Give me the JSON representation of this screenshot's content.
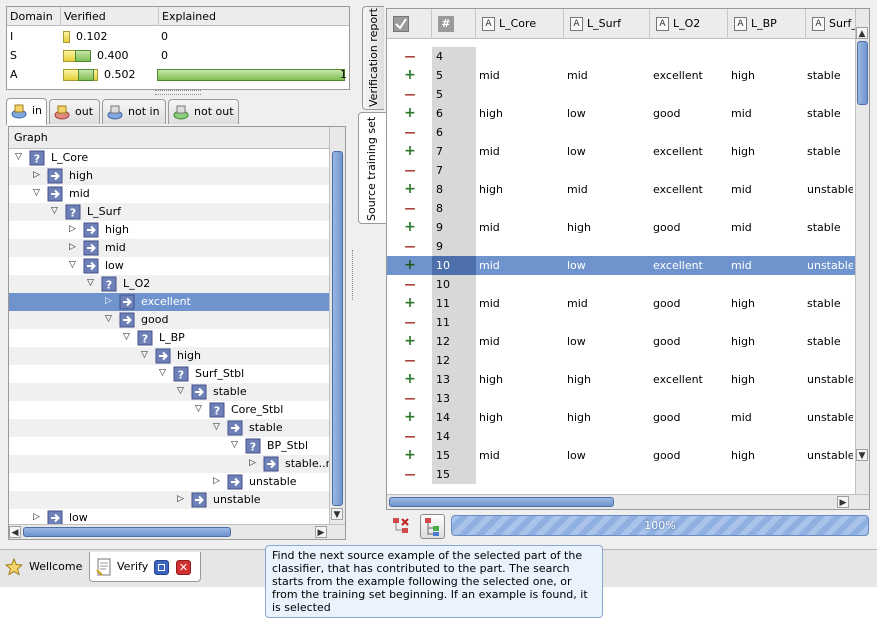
{
  "domain_table": {
    "headers": [
      "Domain",
      "Verified",
      "Explained"
    ],
    "rows": [
      {
        "domain": "I",
        "verified": "0.102",
        "explained": "0",
        "verified_bar": 0.102,
        "explained_bar": 0
      },
      {
        "domain": "S",
        "verified": "0.400",
        "explained": "0",
        "verified_bar": 0.4,
        "explained_bar": 0
      },
      {
        "domain": "A",
        "verified": "0.502",
        "explained": "1",
        "verified_bar": 0.502,
        "explained_bar": 1
      }
    ]
  },
  "left_tabs": [
    {
      "label": "in",
      "icon": "in-icon",
      "active": true
    },
    {
      "label": "out",
      "icon": "out-icon",
      "active": false
    },
    {
      "label": "not in",
      "icon": "not-in-icon",
      "active": false
    },
    {
      "label": "not out",
      "icon": "not-out-icon",
      "active": false
    }
  ],
  "tree": {
    "header": "Graph",
    "rows": [
      {
        "label": "L_Core",
        "depth": 0,
        "expanded": true,
        "type": "question",
        "selected": false
      },
      {
        "label": "high",
        "depth": 1,
        "expanded": false,
        "type": "arrow",
        "selected": false
      },
      {
        "label": "mid",
        "depth": 1,
        "expanded": true,
        "type": "arrow",
        "selected": false
      },
      {
        "label": "L_Surf",
        "depth": 2,
        "expanded": true,
        "type": "question",
        "selected": false
      },
      {
        "label": "high",
        "depth": 3,
        "expanded": false,
        "type": "arrow",
        "selected": false
      },
      {
        "label": "mid",
        "depth": 3,
        "expanded": false,
        "type": "arrow",
        "selected": false
      },
      {
        "label": "low",
        "depth": 3,
        "expanded": true,
        "type": "arrow",
        "selected": false
      },
      {
        "label": "L_O2",
        "depth": 4,
        "expanded": true,
        "type": "question",
        "selected": false
      },
      {
        "label": "excellent",
        "depth": 5,
        "expanded": false,
        "type": "arrow",
        "selected": true
      },
      {
        "label": "good",
        "depth": 5,
        "expanded": true,
        "type": "arrow",
        "selected": false
      },
      {
        "label": "L_BP",
        "depth": 6,
        "expanded": true,
        "type": "question",
        "selected": false
      },
      {
        "label": "high",
        "depth": 7,
        "expanded": true,
        "type": "arrow",
        "selected": false
      },
      {
        "label": "Surf_Stbl",
        "depth": 8,
        "expanded": true,
        "type": "question",
        "selected": false
      },
      {
        "label": "stable",
        "depth": 9,
        "expanded": true,
        "type": "arrow",
        "selected": false
      },
      {
        "label": "Core_Stbl",
        "depth": 10,
        "expanded": true,
        "type": "question",
        "selected": false
      },
      {
        "label": "stable",
        "depth": 11,
        "expanded": true,
        "type": "arrow",
        "selected": false
      },
      {
        "label": "BP_Stbl",
        "depth": 12,
        "expanded": true,
        "type": "question",
        "selected": false
      },
      {
        "label": "stable..r",
        "depth": 13,
        "expanded": false,
        "type": "arrow",
        "selected": false
      },
      {
        "label": "unstable",
        "depth": 11,
        "expanded": false,
        "type": "arrow",
        "selected": false
      },
      {
        "label": "unstable",
        "depth": 9,
        "expanded": false,
        "type": "arrow",
        "selected": false
      },
      {
        "label": "low",
        "depth": 1,
        "expanded": false,
        "type": "arrow",
        "selected": false
      }
    ]
  },
  "vertical_tabs": {
    "verification_report": "Verification report",
    "source_training_set": "Source training set"
  },
  "grid": {
    "hash_header": "#",
    "columns": [
      "L_Core",
      "L_Surf",
      "L_O2",
      "L_BP",
      "Surf_Stbl"
    ],
    "rows": [
      {
        "sign": "-",
        "num": "4",
        "values": [
          "",
          "",
          "",
          "",
          ""
        ]
      },
      {
        "sign": "+",
        "num": "5",
        "values": [
          "mid",
          "mid",
          "excellent",
          "high",
          "stable"
        ]
      },
      {
        "sign": "-",
        "num": "5",
        "values": [
          "",
          "",
          "",
          "",
          ""
        ]
      },
      {
        "sign": "+",
        "num": "6",
        "values": [
          "high",
          "low",
          "good",
          "mid",
          "stable"
        ]
      },
      {
        "sign": "-",
        "num": "6",
        "values": [
          "",
          "",
          "",
          "",
          ""
        ]
      },
      {
        "sign": "+",
        "num": "7",
        "values": [
          "mid",
          "low",
          "excellent",
          "high",
          "stable"
        ]
      },
      {
        "sign": "-",
        "num": "7",
        "values": [
          "",
          "",
          "",
          "",
          ""
        ]
      },
      {
        "sign": "+",
        "num": "8",
        "values": [
          "high",
          "mid",
          "excellent",
          "mid",
          "unstable"
        ]
      },
      {
        "sign": "-",
        "num": "8",
        "values": [
          "",
          "",
          "",
          "",
          ""
        ]
      },
      {
        "sign": "+",
        "num": "9",
        "values": [
          "mid",
          "high",
          "good",
          "mid",
          "stable"
        ]
      },
      {
        "sign": "-",
        "num": "9",
        "values": [
          "",
          "",
          "",
          "",
          ""
        ]
      },
      {
        "sign": "+",
        "num": "10",
        "values": [
          "mid",
          "low",
          "excellent",
          "mid",
          "unstable"
        ],
        "selected": true
      },
      {
        "sign": "-",
        "num": "10",
        "values": [
          "",
          "",
          "",
          "",
          ""
        ]
      },
      {
        "sign": "+",
        "num": "11",
        "values": [
          "mid",
          "mid",
          "good",
          "high",
          "stable"
        ]
      },
      {
        "sign": "-",
        "num": "11",
        "values": [
          "",
          "",
          "",
          "",
          ""
        ]
      },
      {
        "sign": "+",
        "num": "12",
        "values": [
          "mid",
          "low",
          "good",
          "high",
          "stable"
        ]
      },
      {
        "sign": "-",
        "num": "12",
        "values": [
          "",
          "",
          "",
          "",
          ""
        ]
      },
      {
        "sign": "+",
        "num": "13",
        "values": [
          "high",
          "high",
          "excellent",
          "high",
          "unstable"
        ]
      },
      {
        "sign": "-",
        "num": "13",
        "values": [
          "",
          "",
          "",
          "",
          ""
        ]
      },
      {
        "sign": "+",
        "num": "14",
        "values": [
          "high",
          "high",
          "good",
          "mid",
          "unstable"
        ]
      },
      {
        "sign": "-",
        "num": "14",
        "values": [
          "",
          "",
          "",
          "",
          ""
        ]
      },
      {
        "sign": "+",
        "num": "15",
        "values": [
          "mid",
          "low",
          "good",
          "high",
          "unstable"
        ]
      },
      {
        "sign": "-",
        "num": "15",
        "values": [
          "",
          "",
          "",
          "",
          ""
        ]
      }
    ]
  },
  "progress": {
    "label": "100%",
    "value": 1.0
  },
  "bottom_tabs": [
    {
      "label": "Wellcome",
      "icon": "star-icon",
      "active": false
    },
    {
      "label": "Verify",
      "icon": "document-icon",
      "active": true
    }
  ],
  "tooltip": "Find the next source example of the selected part of the classifier, that has contributed to the part. The search starts from the example following the selected one, or from the training set beginning. If an example is found, it is selected",
  "colors": {
    "selection": "#6f94cd",
    "plus": "#2a7a2a",
    "minus": "#a02020"
  }
}
